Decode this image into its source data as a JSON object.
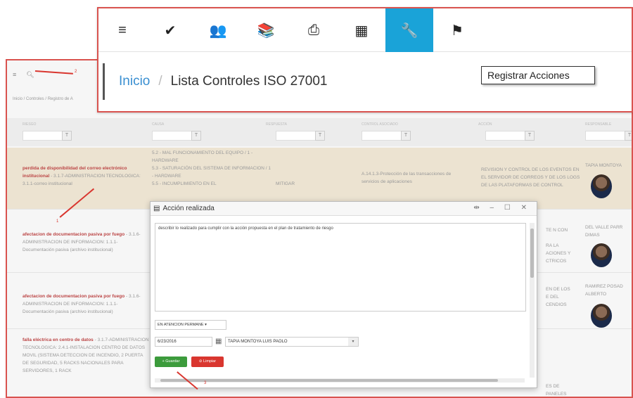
{
  "top_window": {
    "nav_icons": [
      "menu-icon",
      "check-icon",
      "users-icon",
      "book-icon",
      "print-icon",
      "calendar-icon",
      "wrench-icon",
      "flag-icon"
    ],
    "nav_glyphs": [
      "≡",
      "✔",
      "👥",
      "📚",
      "⎙",
      "▦",
      "🔧",
      "⚑"
    ],
    "breadcrumb_home": "Inicio",
    "breadcrumb_sep": "/",
    "page_title": "Lista Controles ISO 27001",
    "tooltip": "Registrar Acciones"
  },
  "background": {
    "breadcrumb": "Inicio / Controles / Registro de A",
    "annot_2": "2",
    "columns": [
      "RIESGO",
      "CAUSA",
      "RESPUESTA",
      "CONTROL ASOCIADO",
      "ACCIÓN",
      "RESPONSABLE"
    ],
    "rows": [
      {
        "riesgo_bold": "perdida de disponibilidad del correo electrónico institucional",
        "riesgo_rest": " - 3.1.7-ADMINISTRACION TECNOLOGICA: 3.1.1-correo institucional",
        "causa": "5.2 - MAL FUNCIONAMIENTO DEL EQUIPO / 1 - HARDWARE\n5.3 - SATURACIÓN DEL SISTEMA DE INFORMACION / 1 - HARDWARE\n5.5 - INCUMPLIMIENTO EN EL",
        "respuesta": "MITIGAR",
        "control": "A.14.1.3-Protección de las transacciones de servicios de aplicaciones",
        "accion": "REVISION Y CONTROL DE LOS EVENTOS EN EL SERVIDOR DE CORREOS Y DE LOS LOGS DE LAS PLATAFORMAS DE CONTROL",
        "responsable": "TAPIA MONTOYA"
      },
      {
        "riesgo_bold": "afectacion de documentacion pasiva por fuego",
        "riesgo_rest": " - 3.1.6-ADMINISTRACION DE INFORMACION: 1.1.1-Documentación pasiva (archivo institucional)",
        "accion": "TE N CON\n\nRA LA\nACIONES Y\nCTRICOS",
        "responsable": "DEL VALLE PARR DIMAS"
      },
      {
        "riesgo_bold": "afectacion de documentacion pasiva por fuego",
        "riesgo_rest": " - 3.1.6-ADMINISTRACION DE INFORMACION: 1.1.1-Documentación pasiva (archivo institucional)",
        "accion": "EN DE LOS\nE DEL\nCENDIOS",
        "responsable": "RAMIREZ POSAD ALBERTO"
      },
      {
        "riesgo_bold": "falla eléctrica en centro de datos",
        "riesgo_rest": " - 3.1.7-ADMINISTRACION TECNOLOGICA: 2.4.1-INSTALACION CENTRO DE DATOS MOVIL (SISTEMA DETECCION DE INCENDIO, 2 PUERTA DE SEGURIDAD, 5 RACKS NACIONALES PARA SERVIDORES, 1 RACK",
        "accion": "ES DE\nPANELES",
        "responsable": ""
      }
    ],
    "annot_1": "1"
  },
  "dialog": {
    "title": "Acción realizada",
    "controls": "⇹ – ☐ ✕",
    "textarea_value": "describir  lo realizado para cumplir con la acción propuesta en el plan de tratamiento de riesgo",
    "status_select": "EN ATENCION PERMANE",
    "date": "6/23/2016",
    "responsible_select": "TAPIA MONTOYA  LUIS PAOLO",
    "save_label": "+ Guardar",
    "clear_label": "⊘ Limpiar",
    "annot_3": "3"
  }
}
